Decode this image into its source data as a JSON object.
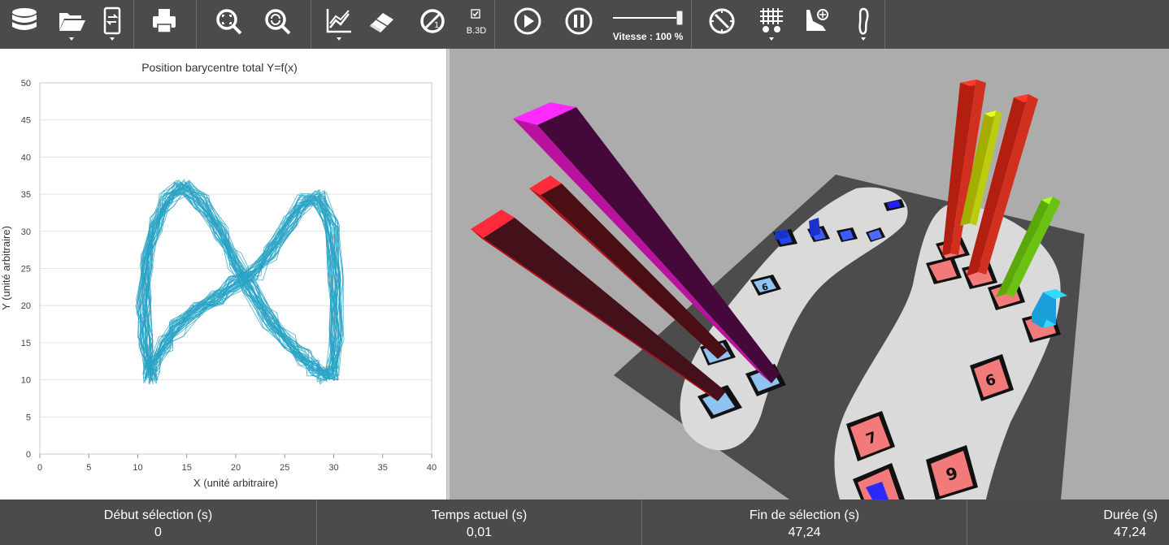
{
  "toolbar": {
    "buttons": [
      {
        "name": "database-icon"
      },
      {
        "name": "folder-open-icon"
      },
      {
        "name": "device-transfer-icon"
      },
      {
        "name": "printer-icon"
      },
      {
        "name": "zoom-fit-icon"
      },
      {
        "name": "zoom-reset-icon"
      },
      {
        "name": "line-chart-icon"
      },
      {
        "name": "eraser-icon"
      },
      {
        "name": "ratio-icon"
      },
      {
        "name": "play-icon"
      },
      {
        "name": "pause-icon"
      },
      {
        "name": "compass-icon"
      },
      {
        "name": "sensor-grid-icon"
      },
      {
        "name": "foot-pressure-icon"
      },
      {
        "name": "footprint-icon"
      }
    ],
    "b3d_label": "B.3D",
    "speed_label": "Vitesse : 100 %",
    "speed_value": 1.0
  },
  "chart_data": {
    "type": "line",
    "title": "Position barycentre total Y=f(x)",
    "xlabel": "X (unité arbitraire)",
    "ylabel": "Y (unité arbitraire)",
    "xlim": [
      0,
      40
    ],
    "ylim": [
      0,
      50
    ],
    "x_ticks": [
      "0",
      "5",
      "10",
      "15",
      "20",
      "25",
      "30",
      "35",
      "40"
    ],
    "y_ticks": [
      "0",
      "5",
      "10",
      "15",
      "20",
      "25",
      "30",
      "35",
      "40",
      "45",
      "50"
    ],
    "series_color": "#2aa3c6",
    "grid": true,
    "series": [
      {
        "x": [
          11.3,
          10.8,
          10.6,
          11.0,
          12.0,
          13.0,
          14.5,
          16.5,
          18.5,
          20.0,
          21.5,
          23.5,
          25.5,
          27.0,
          28.0,
          29.0,
          29.8,
          30.3,
          30.2,
          29.8,
          28.5,
          27.0,
          25.5,
          23.5,
          22.0,
          20.0,
          18.0,
          16.0,
          14.0,
          12.8,
          11.5,
          11.3
        ],
        "y": [
          10.5,
          15.0,
          20.0,
          26.0,
          31.0,
          34.5,
          36.0,
          34.0,
          30.0,
          26.0,
          22.5,
          18.0,
          15.0,
          13.0,
          11.5,
          10.5,
          11.0,
          16.0,
          24.0,
          31.0,
          34.5,
          34.0,
          31.0,
          27.0,
          24.5,
          23.0,
          21.0,
          19.5,
          17.0,
          15.0,
          12.0,
          10.5
        ]
      }
    ]
  },
  "scene": {
    "labels": [
      "6",
      "6",
      "7",
      "9"
    ]
  },
  "status": [
    {
      "label": "Début sélection (s)",
      "value": "0"
    },
    {
      "label": "Temps actuel (s)",
      "value": "0,01"
    },
    {
      "label": "Fin de sélection (s)",
      "value": "47,24"
    },
    {
      "label": "Durée (s)",
      "value": "47,24"
    }
  ]
}
